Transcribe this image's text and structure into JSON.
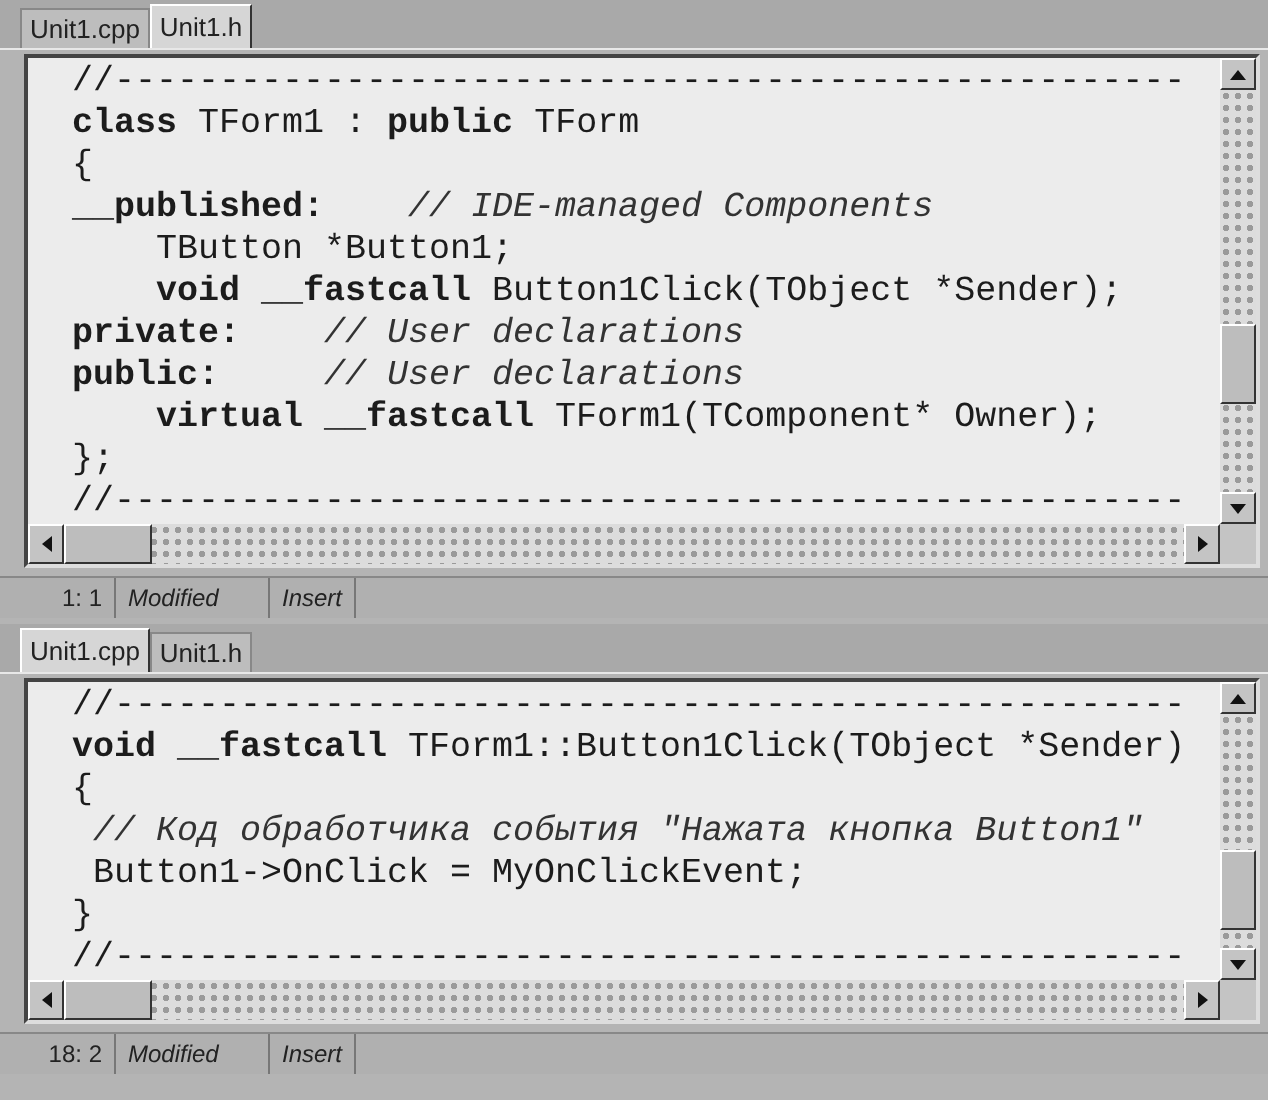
{
  "editors": [
    {
      "tabs": [
        {
          "label": "Unit1.cpp",
          "selected": false
        },
        {
          "label": "Unit1.h",
          "selected": true
        }
      ],
      "code_lines": [
        [
          {
            "kind": "plain",
            "text": "//---------------------------------------------------"
          }
        ],
        [
          {
            "kind": "keyword",
            "text": "class"
          },
          {
            "kind": "plain",
            "text": " TForm1 : "
          },
          {
            "kind": "keyword",
            "text": "public"
          },
          {
            "kind": "plain",
            "text": " TForm"
          }
        ],
        [
          {
            "kind": "plain",
            "text": "{"
          }
        ],
        [
          {
            "kind": "keyword",
            "text": "__published:"
          },
          {
            "kind": "comment",
            "text": "    // IDE-managed Components"
          }
        ],
        [
          {
            "kind": "plain",
            "text": "    TButton *Button1;"
          }
        ],
        [
          {
            "kind": "keyword",
            "text": "    void __fastcall"
          },
          {
            "kind": "plain",
            "text": " Button1Click(TObject *Sender);"
          }
        ],
        [
          {
            "kind": "keyword",
            "text": "private:"
          },
          {
            "kind": "comment",
            "text": "    // User declarations"
          }
        ],
        [
          {
            "kind": "keyword",
            "text": "public:"
          },
          {
            "kind": "comment",
            "text": "     // User declarations"
          }
        ],
        [
          {
            "kind": "keyword",
            "text": "    virtual __fastcall"
          },
          {
            "kind": "plain",
            "text": " TForm1(TComponent* Owner);"
          }
        ],
        [
          {
            "kind": "plain",
            "text": "};"
          }
        ],
        [
          {
            "kind": "plain",
            "text": "//---------------------------------------------------"
          }
        ]
      ],
      "status_bar": {
        "position": "1: 1",
        "modified": "Modified",
        "mode": "Insert"
      }
    },
    {
      "tabs": [
        {
          "label": "Unit1.cpp",
          "selected": true
        },
        {
          "label": "Unit1.h",
          "selected": false
        }
      ],
      "code_lines": [
        [
          {
            "kind": "plain",
            "text": "//---------------------------------------------------"
          }
        ],
        [
          {
            "kind": "keyword",
            "text": "void __fastcall"
          },
          {
            "kind": "plain",
            "text": " TForm1::Button1Click(TObject *Sender)"
          }
        ],
        [
          {
            "kind": "plain",
            "text": "{"
          }
        ],
        [
          {
            "kind": "comment",
            "text": " // Код обработчика события \"Нажата кнопка Button1\""
          }
        ],
        [
          {
            "kind": "plain",
            "text": " Button1->OnClick = MyOnClickEvent;"
          }
        ],
        [
          {
            "kind": "plain",
            "text": "}"
          }
        ],
        [
          {
            "kind": "plain",
            "text": "//---------------------------------------------------"
          }
        ]
      ],
      "status_bar": {
        "position": "18: 2",
        "modified": "Modified",
        "mode": "Insert"
      }
    }
  ]
}
